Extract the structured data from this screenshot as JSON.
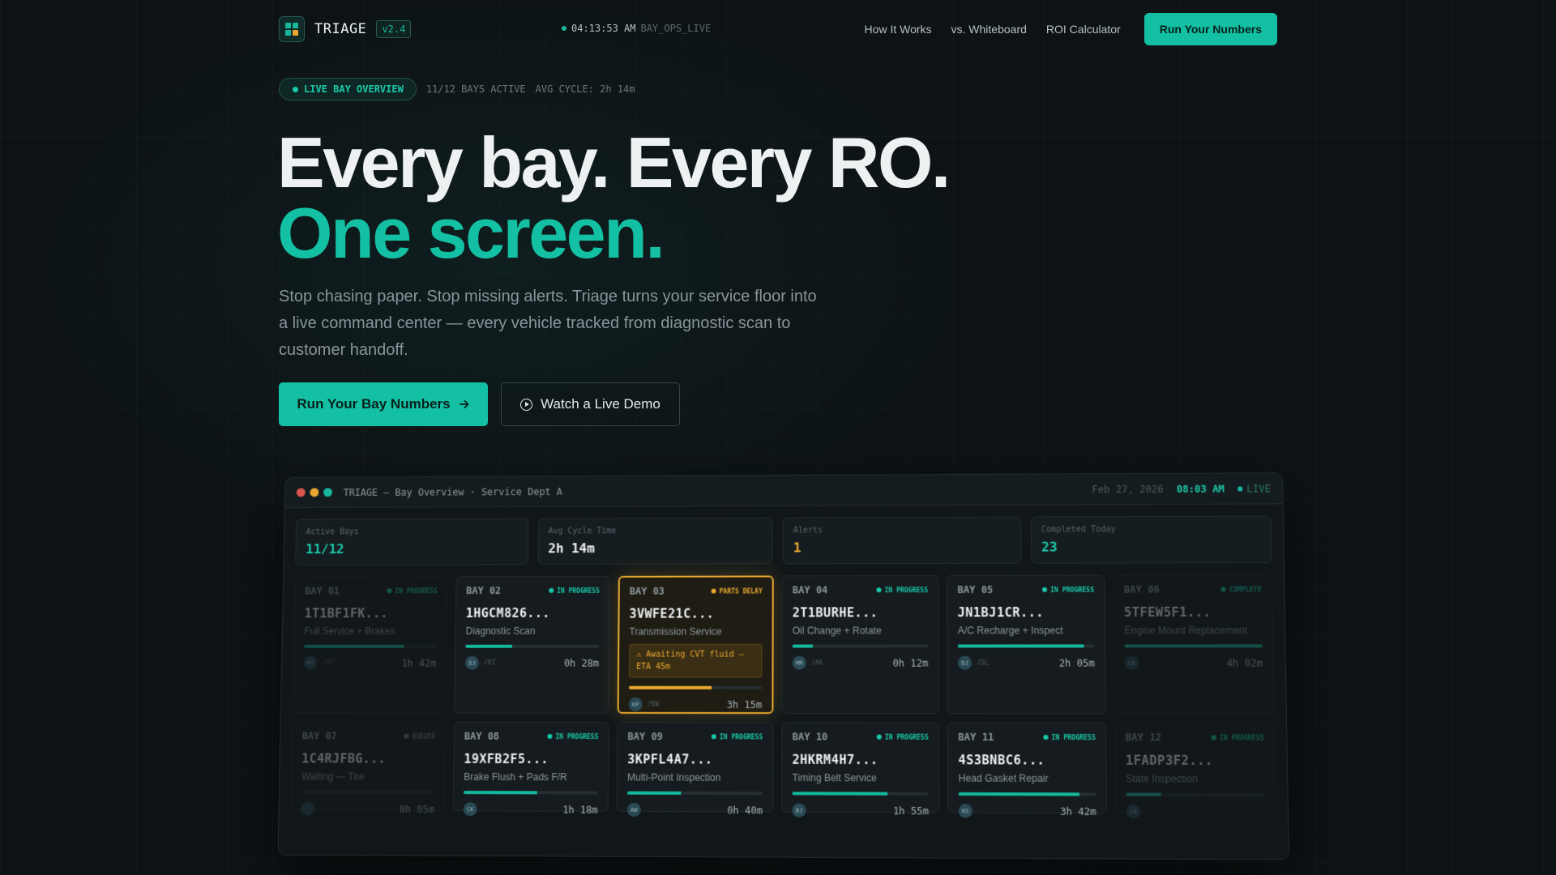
{
  "nav": {
    "brand": "TRIAGE",
    "version": "v2.4",
    "clock": "04:13:53 AM",
    "system": "BAY_OPS_LIVE",
    "links": [
      "How It Works",
      "vs. Whiteboard",
      "ROI Calculator"
    ],
    "cta": "Run Your Numbers"
  },
  "badge": {
    "label": "LIVE BAY OVERVIEW",
    "active": "11/12 BAYS ACTIVE",
    "cycle": "AVG CYCLE: 2h 14m"
  },
  "hero": {
    "line1": "Every bay. Every RO.",
    "line2": "One screen.",
    "sub": "Stop chasing paper. Stop missing alerts. Triage turns your service floor into a live command center — every vehicle tracked from diagnostic scan to customer handoff.",
    "primary": "Run Your Bay Numbers",
    "secondary": "Watch a Live Demo"
  },
  "dashboard": {
    "title": "TRIAGE — Bay Overview · Service Dept A",
    "date": "Feb 27, 2026",
    "time": "08:03 AM",
    "live": "LIVE",
    "stats": [
      {
        "label": "Active Bays",
        "value": "11/12",
        "color": "#19c9a9"
      },
      {
        "label": "Avg Cycle Time",
        "value": "2h 14m",
        "color": "#eef1f2"
      },
      {
        "label": "Alerts",
        "value": "1",
        "color": "#e8a830"
      },
      {
        "label": "Completed Today",
        "value": "23",
        "color": "#19c9a9"
      }
    ],
    "bays": [
      {
        "num": "BAY 01",
        "status": "IN PROGRESS",
        "vin": "1T1BF1FK...",
        "service": "Full Service + Brakes",
        "progress": 0.75,
        "tech": "/MT",
        "avatar": "MT",
        "time": "1h 42m",
        "dim": true
      },
      {
        "num": "BAY 02",
        "status": "IN PROGRESS",
        "vin": "1HGCM826...",
        "service": "Diagnostic Scan",
        "progress": 0.35,
        "tech": "/RT",
        "avatar": "DJ",
        "time": "0h 28m"
      },
      {
        "num": "BAY 03",
        "status": "PARTS DELAY",
        "vin": "3VWFE21C...",
        "service": "Transmission Service",
        "note": "⚠ Awaiting CVT fluid — ETA 45m",
        "progress": 0.62,
        "tech": "/BW",
        "avatar": "KP",
        "time": "3h 15m",
        "alert": true
      },
      {
        "num": "BAY 04",
        "status": "IN PROGRESS",
        "vin": "2T1BURHE...",
        "service": "Oil Change + Rotate",
        "progress": 0.15,
        "tech": "/AK",
        "avatar": "MM",
        "time": "0h 12m"
      },
      {
        "num": "BAY 05",
        "status": "IN PROGRESS",
        "vin": "JN1BJ1CR...",
        "service": "A/C Recharge + Inspect",
        "progress": 0.92,
        "tech": "/DL",
        "avatar": "DJ",
        "time": "2h 05m"
      },
      {
        "num": "BAY 06",
        "status": "COMPLETE",
        "vin": "5TFEW5F1...",
        "service": "Engine Mount Replacement",
        "progress": 1.0,
        "tech": "",
        "avatar": "LR",
        "time": "4h 02m",
        "dim": true
      },
      {
        "num": "BAY 07",
        "status": "QUEUED",
        "vin": "1C4RJFBG...",
        "service": "Waiting — Tire",
        "progress": 0.0,
        "tech": "",
        "avatar": "",
        "time": "0h 05m",
        "dim": true
      },
      {
        "num": "BAY 08",
        "status": "IN PROGRESS",
        "vin": "19XFB2F5...",
        "service": "Brake Flush + Pads F/R",
        "progress": 0.55,
        "tech": "",
        "avatar": "CK",
        "time": "1h 18m"
      },
      {
        "num": "BAY 09",
        "status": "IN PROGRESS",
        "vin": "3KPFL4A7...",
        "service": "Multi-Point Inspection",
        "progress": 0.4,
        "tech": "",
        "avatar": "AW",
        "time": "0h 40m"
      },
      {
        "num": "BAY 10",
        "status": "IN PROGRESS",
        "vin": "2HKRM4H7...",
        "service": "Timing Belt Service",
        "progress": 0.7,
        "tech": "",
        "avatar": "BJ",
        "time": "1h 55m"
      },
      {
        "num": "BAY 11",
        "status": "IN PROGRESS",
        "vin": "4S3BNBC6...",
        "service": "Head Gasket Repair",
        "progress": 0.88,
        "tech": "",
        "avatar": "RS",
        "time": "3h 42m"
      },
      {
        "num": "BAY 12",
        "status": "IN PROGRESS",
        "vin": "1FADP3F2...",
        "service": "State Inspection",
        "progress": 0.25,
        "tech": "",
        "avatar": "LN",
        "time": "",
        "dim": true
      }
    ]
  }
}
